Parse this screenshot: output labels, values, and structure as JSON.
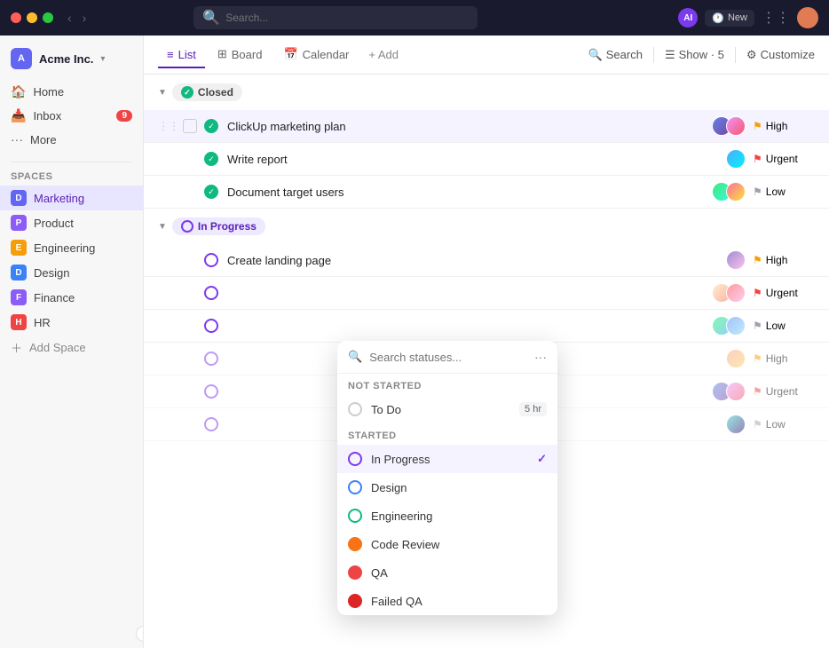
{
  "titlebar": {
    "search_placeholder": "Search...",
    "ai_label": "AI",
    "new_btn": "New"
  },
  "workspace": {
    "name": "Acme Inc.",
    "logo": "A"
  },
  "sidebar": {
    "nav_items": [
      {
        "id": "home",
        "label": "Home",
        "icon": "🏠"
      },
      {
        "id": "inbox",
        "label": "Inbox",
        "icon": "📥",
        "badge": "9"
      },
      {
        "id": "more",
        "label": "More",
        "icon": "⋯"
      }
    ],
    "spaces_label": "Spaces",
    "spaces": [
      {
        "id": "marketing",
        "label": "Marketing",
        "color": "#6366f1",
        "letter": "D",
        "active": true
      },
      {
        "id": "product",
        "label": "Product",
        "color": "#8b5cf6",
        "letter": "P"
      },
      {
        "id": "engineering",
        "label": "Engineering",
        "color": "#f59e0b",
        "letter": "E"
      },
      {
        "id": "design",
        "label": "Design",
        "color": "#3b82f6",
        "letter": "D"
      },
      {
        "id": "finance",
        "label": "Finance",
        "color": "#8b5cf6",
        "letter": "F"
      },
      {
        "id": "hr",
        "label": "HR",
        "color": "#ef4444",
        "letter": "H"
      }
    ],
    "add_space_label": "Add Space"
  },
  "view_tabs": [
    {
      "id": "list",
      "label": "List",
      "icon": "≡",
      "active": true
    },
    {
      "id": "board",
      "label": "Board",
      "icon": "⊞"
    },
    {
      "id": "calendar",
      "label": "Calendar",
      "icon": "📅"
    }
  ],
  "add_view_label": "+ Add",
  "toolbar": {
    "search_label": "Search",
    "show_label": "Show · 5",
    "customize_label": "Customize"
  },
  "sections": [
    {
      "id": "closed",
      "label": "Closed",
      "status": "closed",
      "tasks": [
        {
          "id": "t1",
          "name": "ClickUp marketing plan",
          "priority": "High",
          "priority_type": "high",
          "avatars": [
            "av1",
            "av2"
          ],
          "highlighted": true
        },
        {
          "id": "t2",
          "name": "Write report",
          "priority": "Urgent",
          "priority_type": "urgent",
          "avatars": [
            "av3"
          ]
        },
        {
          "id": "t3",
          "name": "Document target users",
          "priority": "Low",
          "priority_type": "low",
          "avatars": [
            "av4",
            "av5"
          ]
        }
      ]
    },
    {
      "id": "inprogress",
      "label": "In Progress",
      "status": "inprogress",
      "tasks": [
        {
          "id": "t4",
          "name": "Create landing page",
          "priority": "High",
          "priority_type": "high",
          "avatars": [
            "av6"
          ]
        },
        {
          "id": "t5",
          "name": "",
          "priority": "Urgent",
          "priority_type": "urgent",
          "avatars": [
            "av7",
            "av8"
          ]
        },
        {
          "id": "t6",
          "name": "",
          "priority": "Low",
          "priority_type": "low",
          "avatars": [
            "av9",
            "av10"
          ]
        }
      ]
    },
    {
      "id": "section3",
      "tasks": [
        {
          "id": "t7",
          "name": "",
          "priority": "High",
          "priority_type": "high",
          "avatars": [
            "av11"
          ]
        },
        {
          "id": "t8",
          "name": "",
          "priority": "Urgent",
          "priority_type": "urgent",
          "avatars": [
            "av1",
            "av2"
          ]
        },
        {
          "id": "t9",
          "name": "",
          "priority": "Low",
          "priority_type": "low",
          "avatars": [
            "av12"
          ]
        }
      ]
    }
  ],
  "dropdown": {
    "search_placeholder": "Search statuses...",
    "not_started_label": "NOT STARTED",
    "started_label": "STARTED",
    "items": [
      {
        "id": "todo",
        "label": "To Do",
        "type": "todo",
        "time": "5 hr",
        "section": "not_started"
      },
      {
        "id": "inprogress",
        "label": "In Progress",
        "type": "inprogress",
        "section": "started",
        "selected": true
      },
      {
        "id": "design",
        "label": "Design",
        "type": "design",
        "section": "started"
      },
      {
        "id": "engineering",
        "label": "Engineering",
        "type": "engineering",
        "section": "started"
      },
      {
        "id": "codereview",
        "label": "Code Review",
        "type": "codereview",
        "section": "started"
      },
      {
        "id": "qa",
        "label": "QA",
        "type": "qa",
        "section": "started"
      },
      {
        "id": "failedqa",
        "label": "Failed QA",
        "type": "failedqa",
        "section": "started"
      }
    ]
  }
}
